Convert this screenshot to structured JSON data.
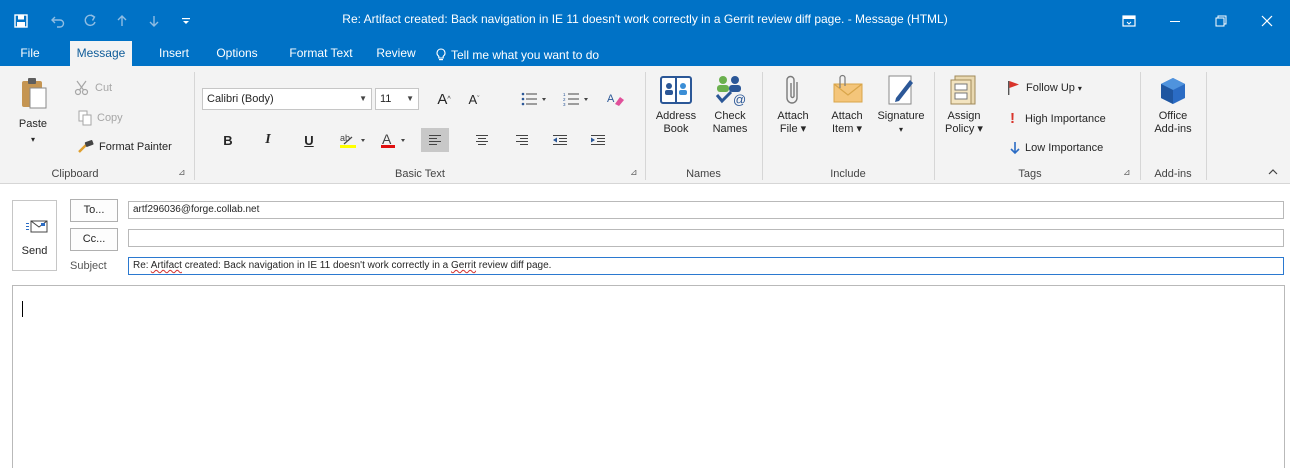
{
  "window": {
    "title": "Re: Artifact created: Back navigation in IE 11 doesn't work correctly in a Gerrit review diff page.  -  Message (HTML)"
  },
  "quick_access": {
    "save_icon": "save-icon",
    "undo_icon": "undo-icon",
    "redo_icon": "redo-icon",
    "up_icon": "arrow-up-icon",
    "down_icon": "arrow-down-icon",
    "customize_icon": "customize-qat-icon"
  },
  "tabs": [
    {
      "label": "File"
    },
    {
      "label": "Message",
      "active": true
    },
    {
      "label": "Insert"
    },
    {
      "label": "Options"
    },
    {
      "label": "Format Text"
    },
    {
      "label": "Review"
    },
    {
      "label": "Tell me what you want to do"
    }
  ],
  "ribbon": {
    "clipboard": {
      "label": "Clipboard",
      "paste": "Paste",
      "cut": "Cut",
      "copy": "Copy",
      "format_painter": "Format Painter"
    },
    "basic_text": {
      "label": "Basic Text",
      "font_name": "Calibri (Body)",
      "font_size": "11",
      "bold": "B",
      "italic": "I",
      "underline": "U"
    },
    "names": {
      "label": "Names",
      "address_book_1": "Address",
      "address_book_2": "Book",
      "check_names_1": "Check",
      "check_names_2": "Names"
    },
    "include": {
      "label": "Include",
      "attach_file_1": "Attach",
      "attach_file_2": "File",
      "attach_item_1": "Attach",
      "attach_item_2": "Item",
      "signature": "Signature"
    },
    "tags": {
      "label": "Tags",
      "assign_policy_1": "Assign",
      "assign_policy_2": "Policy",
      "follow_up": "Follow Up",
      "high_importance": "High Importance",
      "low_importance": "Low Importance"
    },
    "addins": {
      "label": "Add-ins",
      "office_addins_1": "Office",
      "office_addins_2": "Add-ins"
    }
  },
  "compose": {
    "send": "Send",
    "to_button": "To...",
    "cc_button": "Cc...",
    "to_value": "artf296036@forge.collab.net",
    "cc_value": "",
    "subject_label": "Subject",
    "subject_prefix": "Re: ",
    "subject_word1": "Artifact",
    "subject_mid": " created: Back navigation in IE 11 doesn't work correctly in a ",
    "subject_word2": "Gerrit",
    "subject_suffix": " review diff page."
  },
  "colors": {
    "accent": "#0072c6",
    "ribbon_bg": "#f3f3f3",
    "highlight_yellow": "#ffff00",
    "font_red": "#e01010",
    "flag_red": "#d9342b"
  }
}
